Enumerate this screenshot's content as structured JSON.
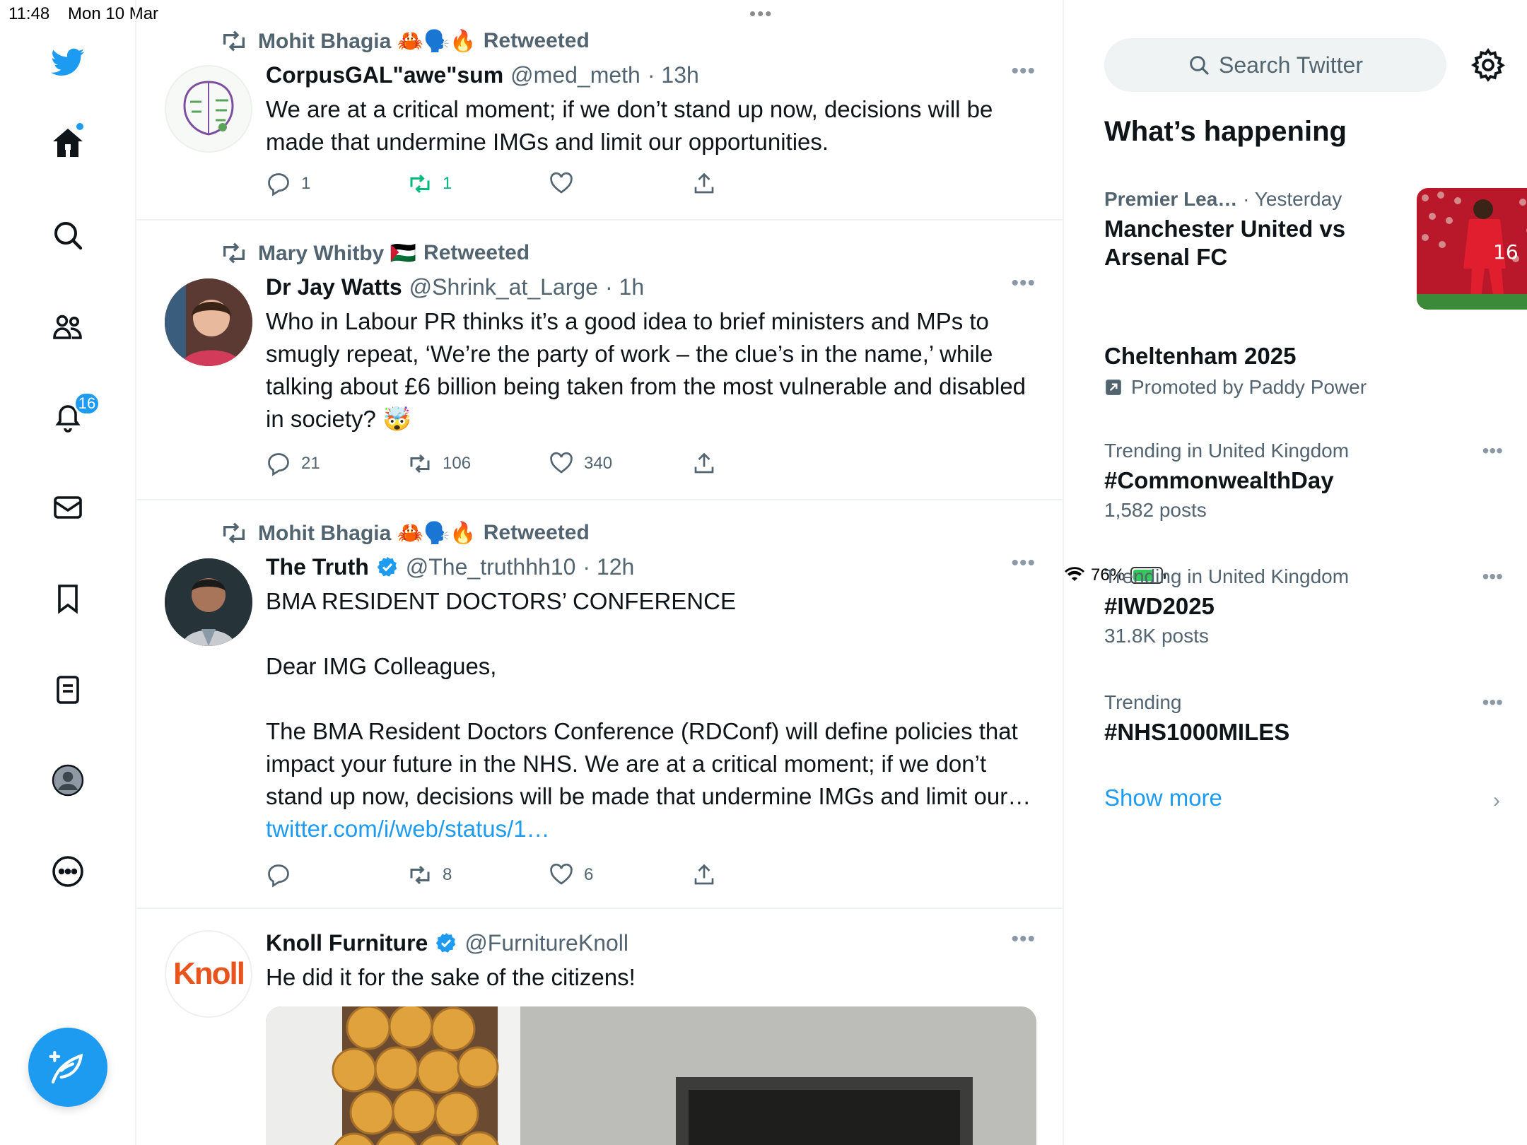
{
  "status_bar": {
    "time": "11:48",
    "date": "Mon 10 Mar",
    "battery": "76%",
    "dots": "•••"
  },
  "nav": {
    "notifications_count": "16"
  },
  "tweets": [
    {
      "retweeted_by": "Mohit Bhagia 🦀🗣️🔥",
      "retweeted_label": "Retweeted",
      "name": "CorpusGAL\"awe\"sum",
      "handle": "@med_meth",
      "time": "· 13h",
      "text": "We are at a critical moment; if we don’t stand up now, decisions will be made that undermine IMGs and limit our opportunities.",
      "replies": "1",
      "retweets": "1",
      "likes": ""
    },
    {
      "retweeted_by": "Mary Whitby 🇵🇸",
      "retweeted_label": "Retweeted",
      "name": "Dr Jay Watts",
      "handle": "@Shrink_at_Large",
      "time": "· 1h",
      "text": "Who in Labour PR thinks it’s a good idea to brief ministers and MPs to smugly repeat, ‘We’re the party of work – the clue’s in the name,’ while talking about £6 billion being taken from the most vulnerable and disabled in society? 🤯",
      "replies": "21",
      "retweets": "106",
      "likes": "340"
    },
    {
      "retweeted_by": "Mohit Bhagia 🦀🗣️🔥",
      "retweeted_label": "Retweeted",
      "name": "The Truth",
      "handle": "@The_truthhh10",
      "time": "· 12h",
      "text": "BMA RESIDENT DOCTORS’ CONFERENCE\n\nDear IMG Colleagues,\n\nThe BMA Resident Doctors Conference (RDConf) will define policies that impact your future in the NHS. We are at a critical moment; if we don’t stand up now, decisions will be made that undermine IMGs and limit our… ",
      "link": "twitter.com/i/web/status/1…",
      "replies": "",
      "retweets": "8",
      "likes": "6"
    },
    {
      "name": "Knoll Furniture",
      "handle": "@FurnitureKnoll",
      "avatar_text": "Knoll",
      "text": "He did it for the sake of the citizens!"
    }
  ],
  "sidebar": {
    "search_placeholder": "Search Twitter",
    "title": "What’s happening",
    "trends": [
      {
        "category": "Premier Lea…",
        "time": "· Yesterday",
        "topic": "Manchester United vs Arsenal FC"
      },
      {
        "topic": "Cheltenham 2025",
        "promoted": "Promoted by Paddy Power"
      },
      {
        "category": "Trending in United Kingdom",
        "topic": "#CommonwealthDay",
        "posts": "1,582 posts"
      },
      {
        "category": "Trending in United Kingdom",
        "topic": "#IWD2025",
        "posts": "31.8K posts"
      },
      {
        "category": "Trending",
        "topic": "#NHS1000MILES"
      }
    ],
    "show_more": "Show more"
  },
  "colors": {
    "accent": "#1d9bf0",
    "retweet_green": "#00ba7c",
    "muted": "#536471"
  }
}
